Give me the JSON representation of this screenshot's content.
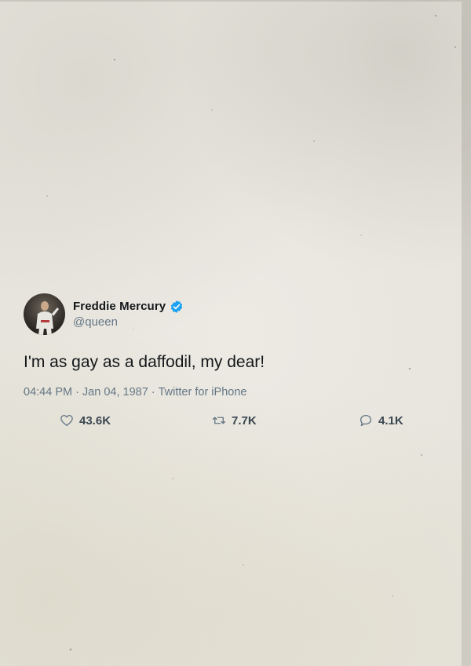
{
  "tweet": {
    "display_name": "Freddie Mercury",
    "handle": "@queen",
    "text": "I'm as gay as a daffodil, my dear!",
    "time": "04:44 PM",
    "date": "Jan 04, 1987",
    "source": "Twitter for iPhone",
    "separator": "·",
    "verified_color": "#1da1f2"
  },
  "stats": {
    "likes": "43.6K",
    "retweets": "7.7K",
    "replies": "4.1K"
  },
  "icons": {
    "likes": "heart-icon",
    "retweets": "retweet-icon",
    "replies": "reply-icon",
    "verified": "verified-badge-icon"
  }
}
